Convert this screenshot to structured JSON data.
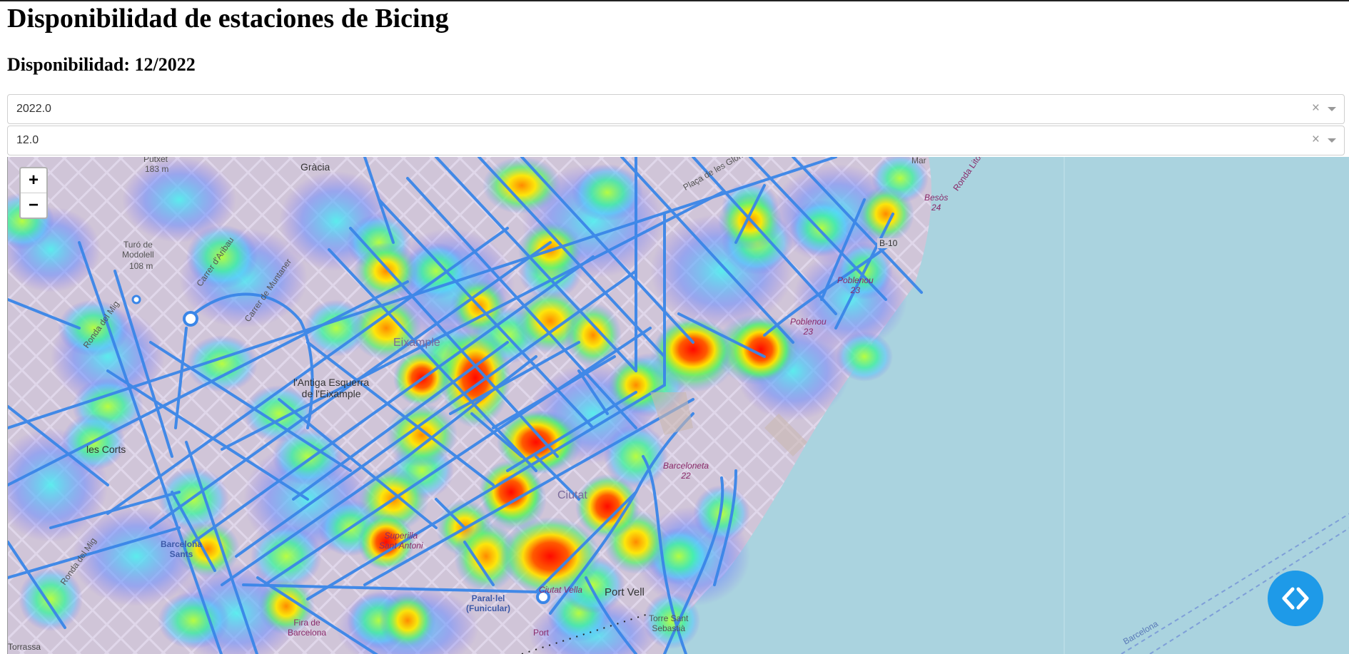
{
  "page": {
    "title": "Disponibilidad de estaciones de Bicing",
    "subtitle": "Disponibilidad: 12/2022"
  },
  "filters": {
    "year": {
      "value": "2022.0",
      "clear": "×"
    },
    "month": {
      "value": "12.0",
      "clear": "×"
    }
  },
  "map": {
    "zoom_in": "+",
    "zoom_out": "−",
    "labels": {
      "gracia": "Gràcia",
      "putxet": "Putxet",
      "putxet_alt": "183 m",
      "turo": "Turó de\nModolell",
      "turo_alt": "108 m",
      "carrer_aribau": "Carrer d'Aribau",
      "carrer_muntaner": "Carrer de Muntaner",
      "ronda_dalt": "Ronda del Mig",
      "eixample": "Eixample",
      "antiga_esquerra": "l'Antiga Esquerra\nde l'Eixample",
      "les_corts": "les Corts",
      "barcelona_sants": "Barcelona\nSants",
      "ronda_mig": "Ronda del Mig",
      "sant_antoni": "Superilla\nSant Antoni",
      "ciutat": "Ciutat",
      "paral_lel": "Paral·lel\n(Funicular)",
      "port_vell": "Port Vell",
      "ciutat_vella": "Ciutat Vella",
      "poblenou_1": "Poblenou\n23",
      "poblenou_2": "Poblenou\n23",
      "besos": "Besòs\n24",
      "b10": "B-10",
      "ronda_litoral": "Ronda Litoral",
      "barceloneta": "Barceloneta\n22",
      "torre_sant": "Torre Sant\nSebastià",
      "placa_glories": "Plaça de les Glòries",
      "mar": "Mar",
      "barcelona_ferry": "Barcelona",
      "port": "Port",
      "torrassa": "Torrassa",
      "fira": "Fira de\nBarcelona"
    }
  },
  "colors": {
    "sea": "#aad3df",
    "land": "#d9d3cc",
    "route": "#3a86e8",
    "fab": "#1e9ae8"
  },
  "heatmap_levels": [
    "low",
    "medium",
    "high",
    "very-high"
  ]
}
